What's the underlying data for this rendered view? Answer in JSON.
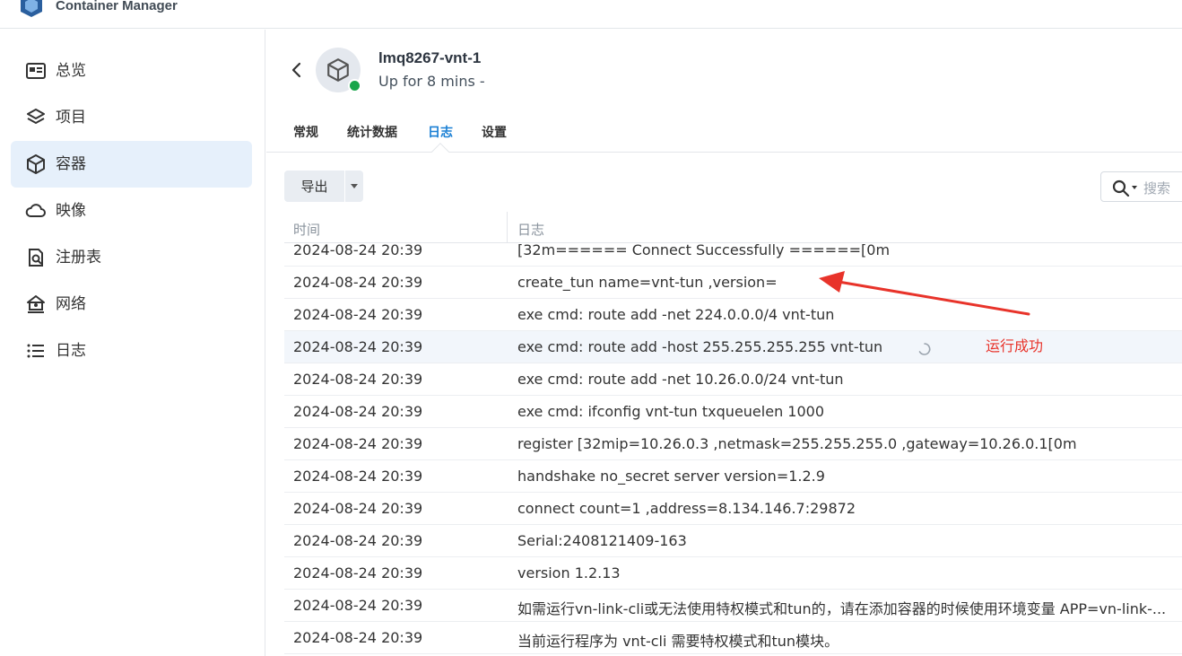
{
  "app": {
    "title": "Container Manager"
  },
  "sidebar": {
    "items": [
      {
        "label": "总览",
        "icon": "overview-icon",
        "active": false
      },
      {
        "label": "项目",
        "icon": "layers-icon",
        "active": false
      },
      {
        "label": "容器",
        "icon": "cube-icon",
        "active": true
      },
      {
        "label": "映像",
        "icon": "cloud-icon",
        "active": false
      },
      {
        "label": "注册表",
        "icon": "registry-search-icon",
        "active": false
      },
      {
        "label": "网络",
        "icon": "network-house-icon",
        "active": false
      },
      {
        "label": "日志",
        "icon": "list-icon",
        "active": false
      }
    ]
  },
  "container": {
    "name": "lmq8267-vnt-1",
    "status": "Up for 8 mins -",
    "status_color": "#17a54a"
  },
  "tabs": [
    {
      "label": "常规",
      "active": false
    },
    {
      "label": "统计数据",
      "active": false
    },
    {
      "label": "日志",
      "active": true
    },
    {
      "label": "设置",
      "active": false
    }
  ],
  "toolbar": {
    "export_label": "导出",
    "search_placeholder": "搜索"
  },
  "table": {
    "headers": {
      "time": "时间",
      "log": "日志"
    },
    "rows": [
      {
        "time": "2024-08-24 20:39",
        "log": "[32m====== Connect Successfully ======[0m"
      },
      {
        "time": "2024-08-24 20:39",
        "log": "create_tun name=vnt-tun ,version="
      },
      {
        "time": "2024-08-24 20:39",
        "log": "exe cmd: route add -net 224.0.0.0/4 vnt-tun"
      },
      {
        "time": "2024-08-24 20:39",
        "log": "exe cmd: route add -host 255.255.255.255 vnt-tun"
      },
      {
        "time": "2024-08-24 20:39",
        "log": "exe cmd: route add -net 10.26.0.0/24 vnt-tun"
      },
      {
        "time": "2024-08-24 20:39",
        "log": "exe cmd: ifconfig vnt-tun txqueuelen 1000"
      },
      {
        "time": "2024-08-24 20:39",
        "log": "register [32mip=10.26.0.3 ,netmask=255.255.255.0 ,gateway=10.26.0.1[0m"
      },
      {
        "time": "2024-08-24 20:39",
        "log": "handshake no_secret server version=1.2.9"
      },
      {
        "time": "2024-08-24 20:39",
        "log": "connect count=1 ,address=8.134.146.7:29872"
      },
      {
        "time": "2024-08-24 20:39",
        "log": "Serial:2408121409-163"
      },
      {
        "time": "2024-08-24 20:39",
        "log": "version 1.2.13"
      },
      {
        "time": "2024-08-24 20:39",
        "log": "如需运行vn-link-cli或无法使用特权模式和tun的，请在添加容器的时候使用环境变量 APP=vn-link-..."
      },
      {
        "time": "2024-08-24 20:39",
        "log": "当前运行程序为 vnt-cli 需要特权模式和tun模块。"
      }
    ]
  },
  "annotation": {
    "text": "运行成功",
    "color": "#e8332a"
  },
  "colors": {
    "accent": "#1a7fd4",
    "active_nav_bg": "#e6f0fb"
  }
}
